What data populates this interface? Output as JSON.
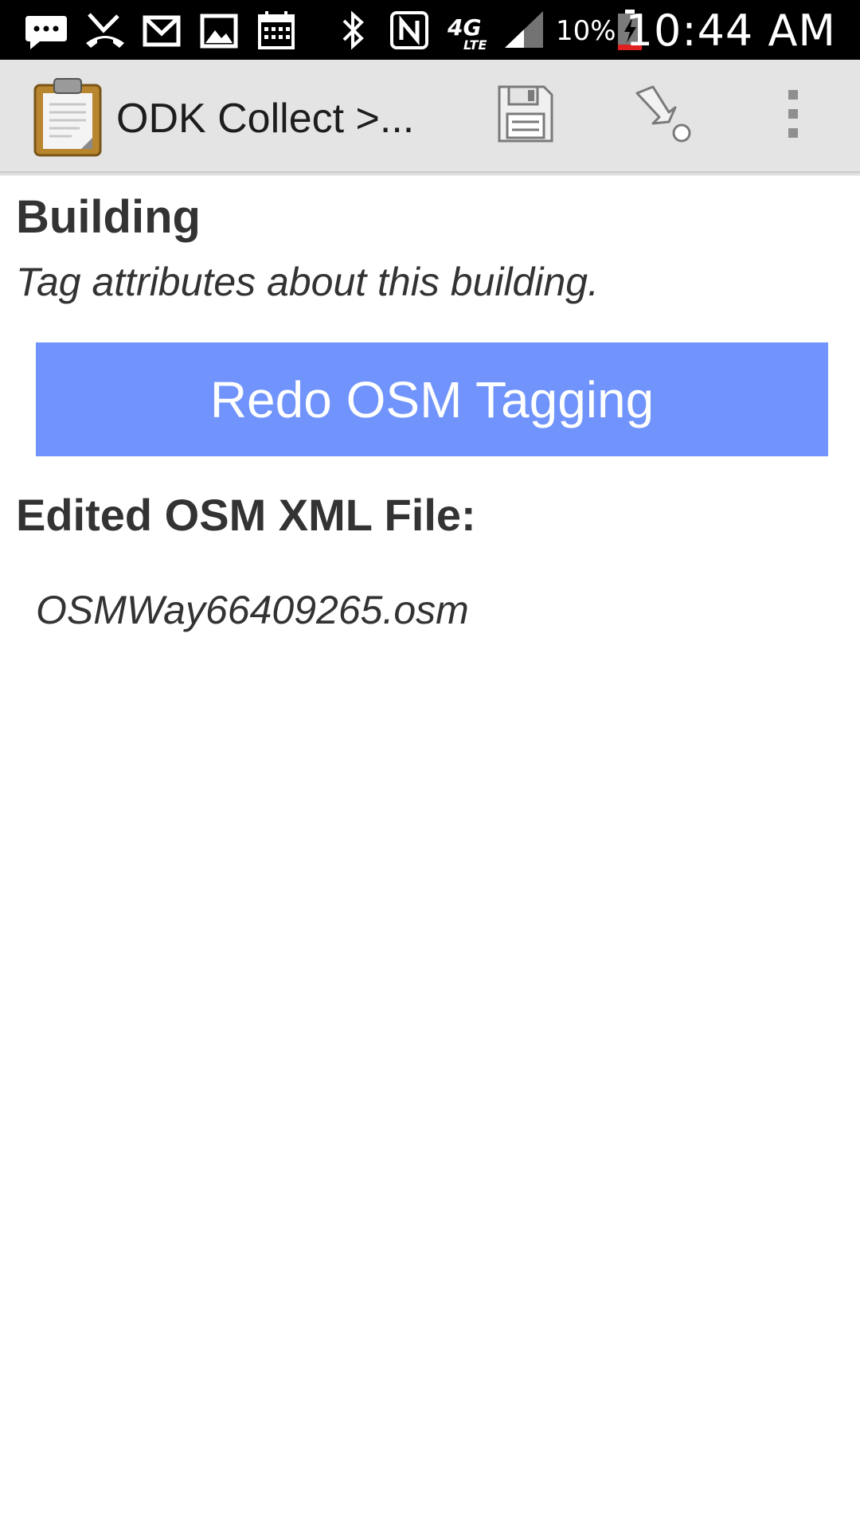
{
  "status_bar": {
    "icons": [
      "messages-icon",
      "missed-call-icon",
      "gmail-icon",
      "gallery-icon",
      "calendar-icon",
      "bluetooth-icon",
      "nfc-icon",
      "4g-lte-icon",
      "signal-icon",
      "battery-icon"
    ],
    "battery_percent": "10%",
    "time": "10:44 AM"
  },
  "action_bar": {
    "app_icon": "clipboard-icon",
    "title": "ODK Collect >...",
    "actions": [
      "save-icon",
      "go-to-prompt-icon",
      "overflow-menu-icon"
    ]
  },
  "question": {
    "label": "Building",
    "hint": "Tag attributes about this building.",
    "button_label": "Redo OSM Tagging",
    "file_label": "Edited OSM XML File:",
    "file_name": "OSMWay66409265.osm"
  },
  "colors": {
    "status_bar_bg": "#000000",
    "action_bar_bg": "#e4e4e4",
    "button_bg": "#7094fb",
    "text": "#333333"
  }
}
